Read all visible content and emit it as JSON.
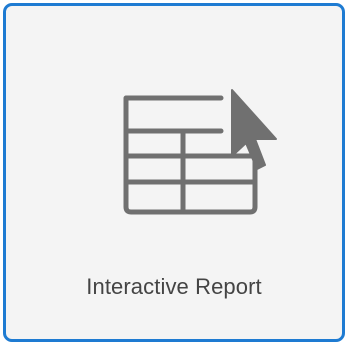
{
  "tile": {
    "label": "Interactive Report",
    "icon": "table-with-cursor-icon",
    "selected": true
  },
  "colors": {
    "border": "#1e7bd2",
    "background": "#f4f4f4",
    "icon": "#707070",
    "label": "#444444"
  }
}
